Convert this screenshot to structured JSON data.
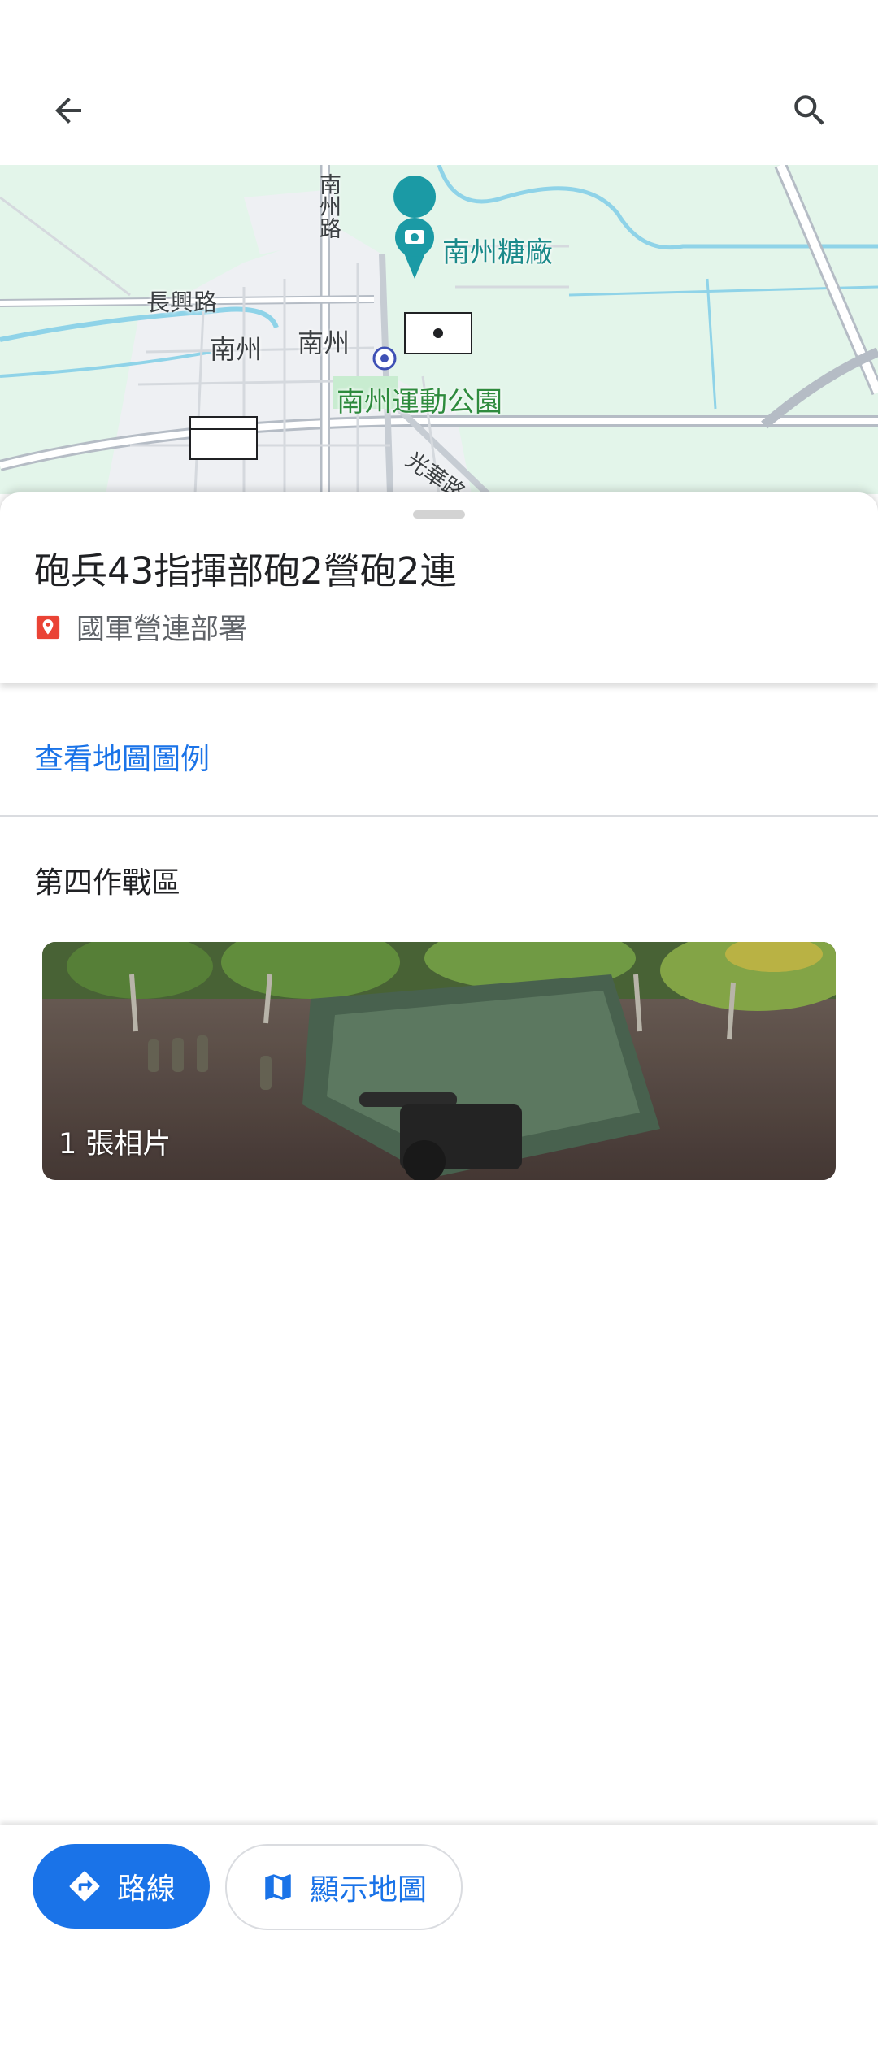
{
  "topbar": {
    "back_icon": "arrow-back-icon",
    "search_icon": "search-icon"
  },
  "map": {
    "labels": {
      "road_changxing": "長興路",
      "town_nanzhou_1": "南州",
      "town_nanzhou_2": "南州",
      "road_nanzhou": "南州路",
      "poi_sugar_factory": "南州糖廠",
      "park": "南州運動公園",
      "road_guanghua": "光華路"
    },
    "colors": {
      "land": "#e3f5ea",
      "urban": "#eef0f3",
      "water": "#8fd3e8",
      "poi": "#1b8a8a",
      "park_text": "#2e8b3d"
    }
  },
  "place": {
    "title": "砲兵43指揮部砲2營砲2連",
    "type": "國軍營連部署",
    "type_icon": "map-pin-icon"
  },
  "legend_link": "查看地圖圖例",
  "region": "第四作戰區",
  "photos": {
    "count_label": "1 張相片"
  },
  "actions": {
    "route_label": "路線",
    "route_icon": "directions-icon",
    "map_label": "顯示地圖",
    "map_icon": "map-icon"
  },
  "colors": {
    "accent": "#1a73e8",
    "pin_red": "#ea4335"
  }
}
